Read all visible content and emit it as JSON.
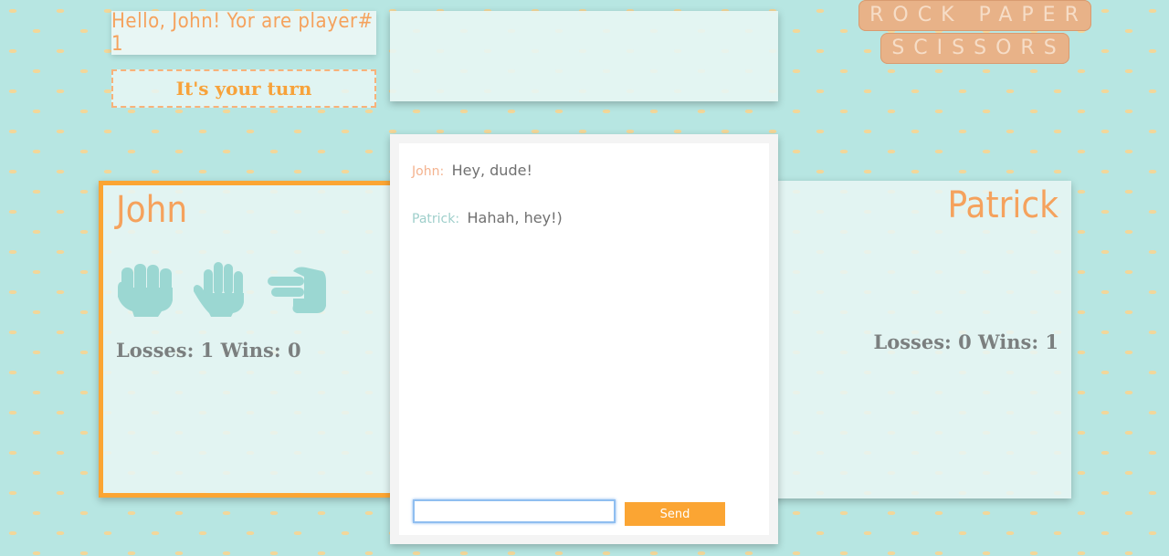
{
  "greeting": {
    "text": "Hello, John! Yor are player# 1"
  },
  "turn": {
    "text": "It's your turn"
  },
  "logo": {
    "lines": [
      "ROCK PAPER",
      "SCISSORS"
    ]
  },
  "players": {
    "left": {
      "name": "John",
      "losses_label": "Losses: 1",
      "wins_label": "Wins: 0"
    },
    "right": {
      "name": "Patrick",
      "losses_label": "Losses: 0",
      "wins_label": "Wins: 1"
    }
  },
  "choices": [
    {
      "name": "rock",
      "icon": "fist-icon"
    },
    {
      "name": "paper",
      "icon": "open-hand-icon"
    },
    {
      "name": "scissors",
      "icon": "scissors-hand-icon"
    }
  ],
  "chat": {
    "messages": [
      {
        "author": "John:",
        "text": "Hey, dude!",
        "color": "#f4b38f"
      },
      {
        "author": "Patrick:",
        "text": "Hahah, hey!)",
        "color": "#9fcfcb"
      }
    ],
    "input_value": "",
    "send_label": "Send"
  },
  "colors": {
    "accent": "#fba533",
    "icon": "#9bd7d2",
    "name": "#f5a25d"
  }
}
